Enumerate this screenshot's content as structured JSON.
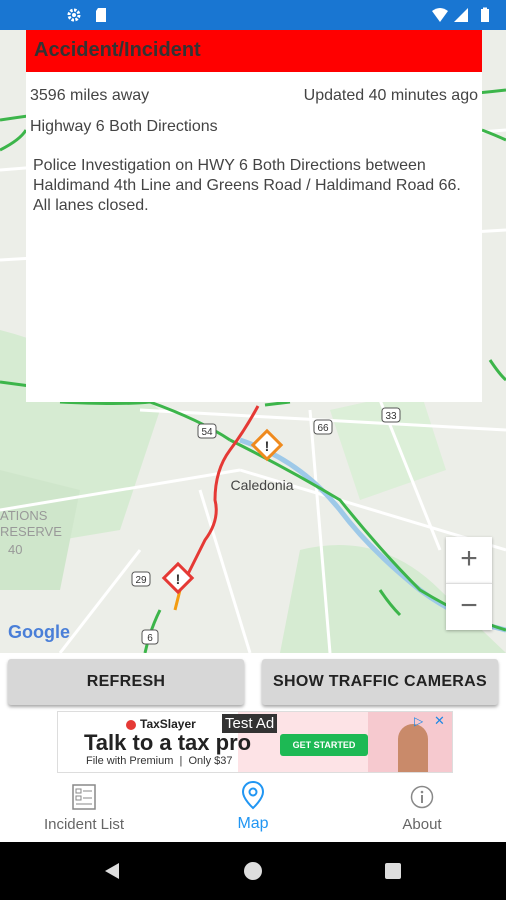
{
  "popup": {
    "title": "Accident/Incident",
    "distance": "3596 miles away",
    "updated": "Updated 40 minutes ago",
    "road": "Highway 6 Both Directions",
    "description": "Police Investigation on HWY 6 Both Directions  between Haldimand 4th Line and Greens Road / Haldimand Road 66. All lanes closed."
  },
  "map": {
    "town_label": "Caledonia",
    "reserve_label_lines": [
      "ATIONS",
      "RESERVE",
      "40"
    ],
    "road_shields": [
      "54",
      "66",
      "33",
      "29",
      "6"
    ],
    "google_label": "Google",
    "zoom_in": "+",
    "zoom_out": "−"
  },
  "buttons": {
    "refresh": "REFRESH",
    "show_cameras": "SHOW TRAFFIC CAMERAS"
  },
  "ad": {
    "test_label": "Test Ad",
    "brand": "TaxSlayer",
    "headline": "Talk to a tax pro",
    "sub": "File with Premium  |  Only $37",
    "cta": "GET STARTED"
  },
  "tabs": [
    {
      "label": "Incident List",
      "icon": "list-icon",
      "active": false
    },
    {
      "label": "Map",
      "icon": "location-pin-icon",
      "active": true
    },
    {
      "label": "About",
      "icon": "info-icon",
      "active": false
    }
  ],
  "colors": {
    "status_bar": "#1976d2",
    "popup_header": "#ff0000",
    "active_tab": "#2196f3",
    "traffic_green": "#3cb54a",
    "traffic_red": "#e53935"
  }
}
